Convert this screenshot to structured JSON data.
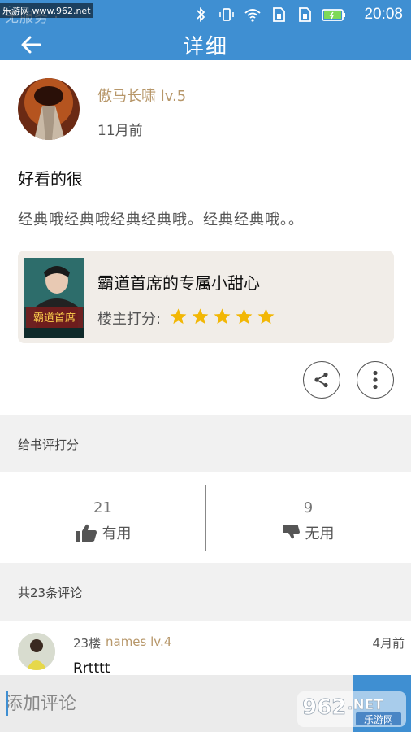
{
  "statusbar": {
    "left_text": "无服务 ·",
    "watermark": "乐游网 www.962.net",
    "time": "20:08",
    "icons": [
      "bluetooth-icon",
      "vibrate-icon",
      "wifi-icon",
      "sim1-icon",
      "sim2-icon",
      "battery-icon"
    ]
  },
  "header": {
    "title": "详细",
    "back_icon": "arrow-left-icon"
  },
  "post": {
    "author": "傲马长啸 lv.5",
    "time": "11月前",
    "title": "好看的很",
    "body": "经典哦经典哦经典经典哦。经典经典哦。。"
  },
  "book": {
    "title": "霸道首席的专属小甜心",
    "rating_label": "楼主打分:",
    "rating": 5,
    "rating_max": 5,
    "cover_text": "霸道首席",
    "star_color": "#f2b705"
  },
  "actions": {
    "share_icon": "share-icon",
    "more_icon": "more-vertical-icon"
  },
  "rate_section": {
    "label": "给书评打分"
  },
  "votes": {
    "useful_count": "21",
    "useful_label": "有用",
    "useless_count": "9",
    "useless_label": "无用"
  },
  "comments_section": {
    "label": "共23条评论"
  },
  "comment": {
    "floor": "23楼",
    "name": "names lv.4",
    "time": "4月前",
    "text": "Rrtttt"
  },
  "input": {
    "placeholder": "添加评论"
  },
  "watermark_logo": {
    "big": "962",
    "suffix": ".NET",
    "sub": "乐游网"
  },
  "colors": {
    "accent": "#3f8fd2",
    "gold": "#b7976a",
    "band": "#f1f1f1",
    "card": "#f1ede8"
  }
}
